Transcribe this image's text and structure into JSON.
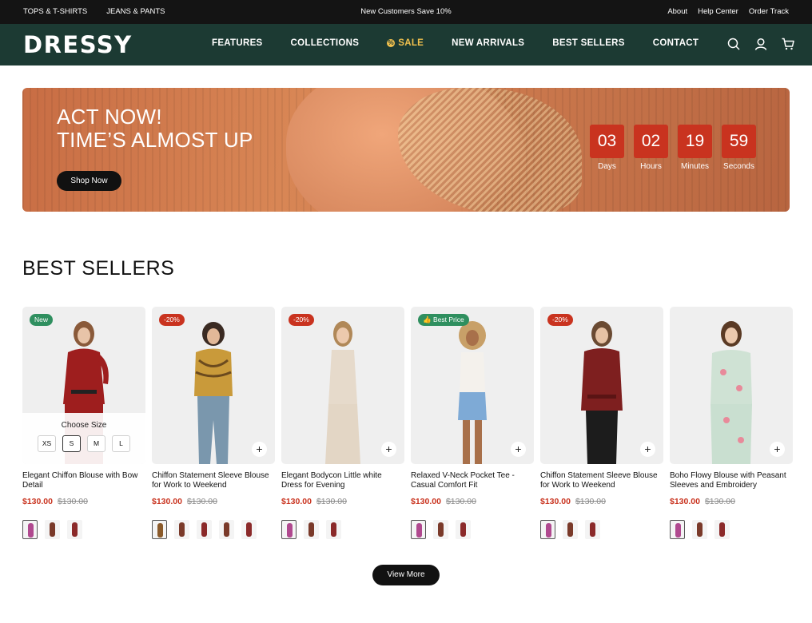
{
  "topbar": {
    "left_links": [
      "TOPS & T-SHIRTS",
      "JEANS & PANTS"
    ],
    "promo": "New Customers Save 10%",
    "right_links": [
      "About",
      "Help Center",
      "Order Track"
    ]
  },
  "nav": {
    "logo": "DRESSY",
    "items": [
      "FEATURES",
      "COLLECTIONS",
      "SALE",
      "NEW ARRIVALS",
      "BEST SELLERS",
      "CONTACT"
    ],
    "icons": [
      "search-icon",
      "user-icon",
      "cart-icon"
    ]
  },
  "hero": {
    "line1": "ACT NOW!",
    "line2": "TIME’S ALMOST UP",
    "cta": "Shop Now",
    "countdown": [
      {
        "value": "03",
        "label": "Days"
      },
      {
        "value": "02",
        "label": "Hours"
      },
      {
        "value": "19",
        "label": "Minutes"
      },
      {
        "value": "59",
        "label": "Seconds"
      }
    ]
  },
  "best_sellers": {
    "title": "BEST SELLERS",
    "size_prompt": "Choose Size",
    "sizes": [
      "XS",
      "S",
      "M",
      "L"
    ],
    "selected_size": "S",
    "products": [
      {
        "badge": "New",
        "name": "Elegant Chiffon Blouse with Bow Detail",
        "price": "$130.00",
        "old_price": "$130.00"
      },
      {
        "badge": "-20%",
        "name": "Chiffon Statement Sleeve Blouse for Work to Weekend",
        "price": "$130.00",
        "old_price": "$130.00"
      },
      {
        "badge": "-20%",
        "name": "Elegant Bodycon Little white Dress for Evening",
        "price": "$130.00",
        "old_price": "$130.00"
      },
      {
        "badge": "Best Price",
        "name": "Relaxed V-Neck Pocket Tee - Casual Comfort Fit",
        "price": "$130.00",
        "old_price": "$130.00"
      },
      {
        "badge": "-20%",
        "name": "Chiffon Statement Sleeve Blouse for Work to Weekend",
        "price": "$130.00",
        "old_price": "$130.00"
      },
      {
        "badge": "",
        "name": "Boho Flowy Blouse with Peasant Sleeves and Embroidery",
        "price": "$130.00",
        "old_price": "$130.00"
      }
    ],
    "view_more": "View More"
  },
  "colors": {
    "topbar": "#141414",
    "nav": "#1c3a33",
    "accent_red": "#c9331f",
    "sale_yellow": "#f2c14e",
    "badge_green": "#2f8f5f"
  }
}
